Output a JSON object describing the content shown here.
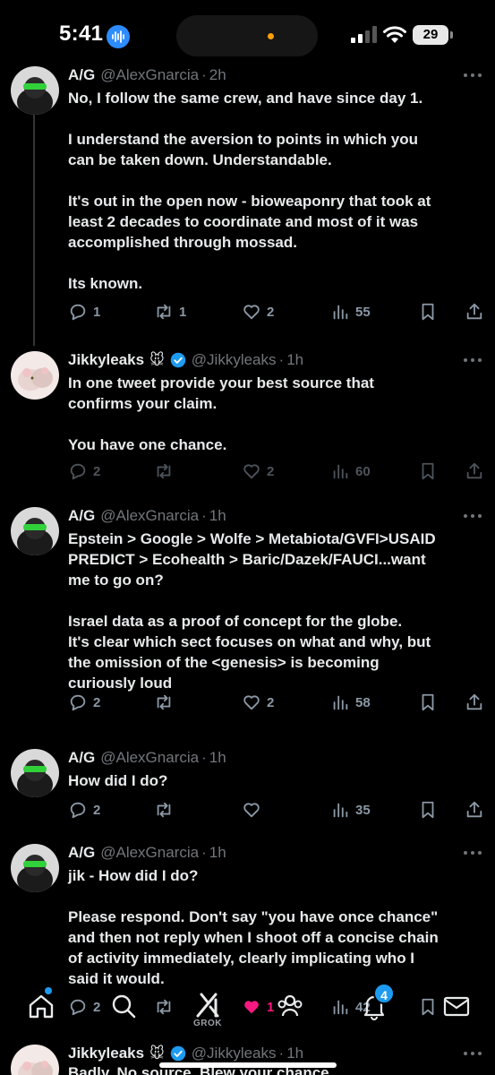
{
  "status_bar": {
    "time": "5:41",
    "battery": "29"
  },
  "tweets": [
    {
      "name": "A/G",
      "handle": "@AlexGnarcia",
      "time": "2h",
      "emoji": "",
      "verified": false,
      "lines": [
        "No, I follow the same crew, and have since day 1.",
        "",
        "I understand the aversion to points in which you",
        "can be taken down. Understandable.",
        "",
        "It's out in the open now - bioweaponry that took at",
        "least 2 decades to coordinate and most of it was",
        "accomplished through mossad.",
        "",
        "Its known."
      ],
      "replies": "1",
      "reposts": "1",
      "likes": "2",
      "views": "55"
    },
    {
      "name": "Jikkyleaks",
      "handle": "@Jikkyleaks",
      "time": "1h",
      "emoji": "🐭",
      "verified": true,
      "lines": [
        "In one tweet provide your best source that",
        "confirms your claim.",
        "",
        "You have one chance."
      ],
      "replies": "2",
      "reposts": "",
      "likes": "2",
      "views": "60"
    },
    {
      "name": "A/G",
      "handle": "@AlexGnarcia",
      "time": "1h",
      "emoji": "",
      "verified": false,
      "lines": [
        "Epstein > Google > Wolfe > Metabiota/GVFI>USAID",
        "PREDICT > Ecohealth > Baric/Dazek/FAUCI...want",
        "me to go on?",
        "",
        "Israel data as a proof of concept for the globe.",
        "It's clear which sect focuses on what and why, but",
        "the omission of the <genesis> is becoming",
        "curiously loud"
      ],
      "replies": "2",
      "reposts": "",
      "likes": "2",
      "views": "58"
    },
    {
      "name": "A/G",
      "handle": "@AlexGnarcia",
      "time": "1h",
      "emoji": "",
      "verified": false,
      "lines": [
        "How did I do?"
      ],
      "replies": "2",
      "reposts": "",
      "likes": "",
      "views": "35"
    },
    {
      "name": "A/G",
      "handle": "@AlexGnarcia",
      "time": "1h",
      "emoji": "",
      "verified": false,
      "lines": [
        "jik - How did I do?",
        "",
        "Please respond. Don't say \"you have once chance\"",
        "and then not reply when I shoot off a concise chain",
        "of activity immediately, clearly implicating who I",
        "said it would."
      ],
      "replies": "2",
      "reposts": "",
      "likes": "1",
      "views": "42"
    },
    {
      "name": "Jikkyleaks",
      "handle": "@Jikkyleaks",
      "time": "1h",
      "emoji": "🐭",
      "verified": true,
      "lines": [
        "Badly. No source. Blew your chance."
      ],
      "replies": "",
      "reposts": "",
      "likes": "",
      "views": ""
    }
  ],
  "bottom_nav": {
    "items": [
      "home-icon",
      "search-icon",
      "grok-icon",
      "communities-icon",
      "notifications-icon",
      "messages-icon"
    ],
    "grok_label": "GROK",
    "notifications_badge": "4"
  },
  "colors": {
    "background": "#000000",
    "text": "#e7e9ea",
    "muted": "#71767b",
    "accent": "#1d9bf0",
    "like": "#f91880"
  }
}
